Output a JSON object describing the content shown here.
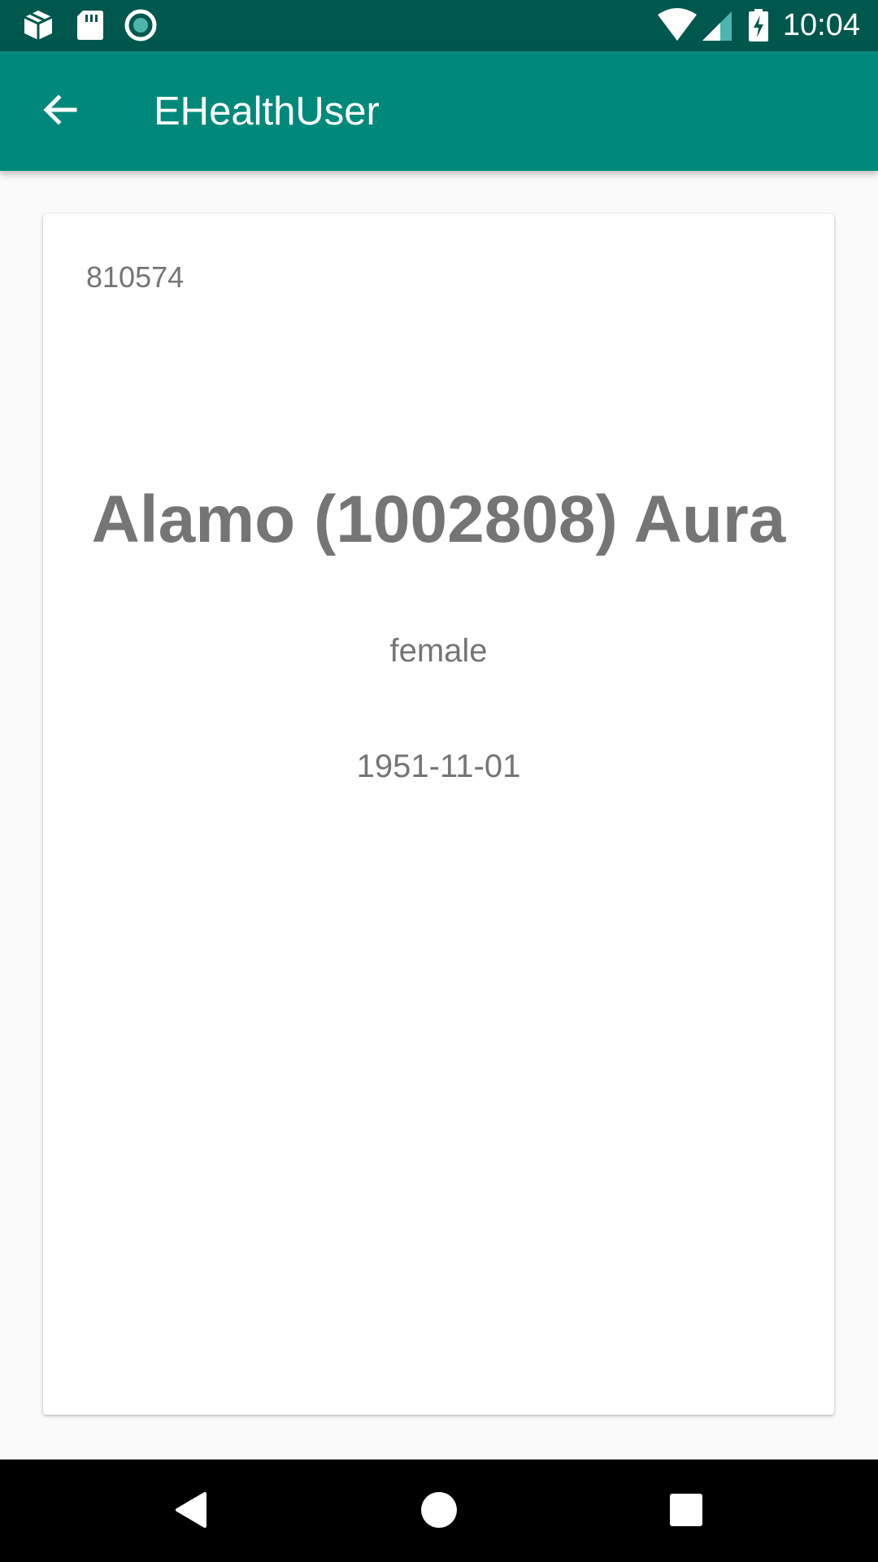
{
  "status_bar": {
    "time": "10:04",
    "icons": [
      "package-icon",
      "sd-card-icon",
      "record-icon",
      "wifi-icon",
      "cell-signal-icon",
      "battery-charging-icon"
    ]
  },
  "app_bar": {
    "title": "EHealthUser",
    "back_icon": "arrow-back-icon"
  },
  "user_card": {
    "id": "810574",
    "name": "Alamo (1002808) Aura",
    "gender": "female",
    "birthdate": "1951-11-01"
  },
  "nav_bar": {
    "buttons": [
      "back-triangle-icon",
      "home-circle-icon",
      "recents-square-icon"
    ]
  },
  "colors": {
    "status_bar": "#00574d",
    "app_bar": "#00897b",
    "text_secondary": "#757575",
    "background": "#fafafa",
    "nav_bar": "#000000"
  }
}
